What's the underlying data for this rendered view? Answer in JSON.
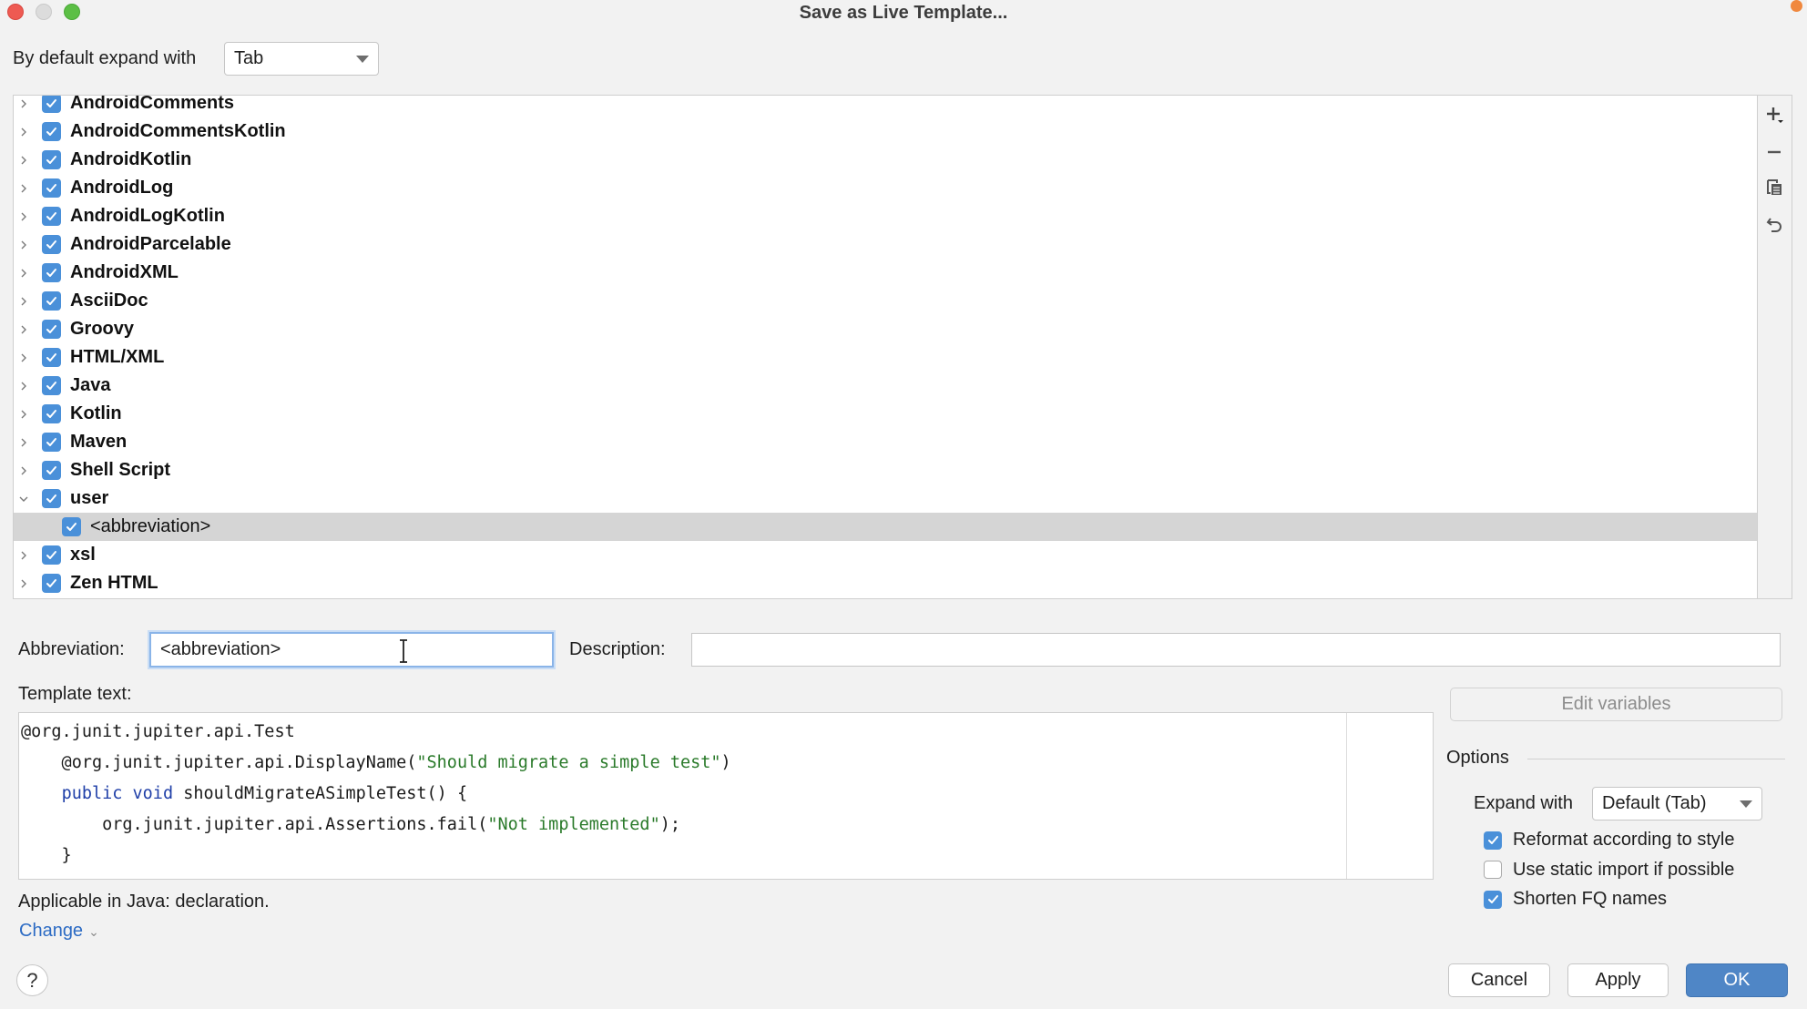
{
  "window": {
    "title": "Save as Live Template..."
  },
  "header": {
    "expand_label": "By default expand with",
    "expand_value": "Tab"
  },
  "tree": {
    "items": [
      {
        "label": "AndroidComments",
        "expanded": false,
        "checked": true,
        "level": 0
      },
      {
        "label": "AndroidCommentsKotlin",
        "expanded": false,
        "checked": true,
        "level": 0
      },
      {
        "label": "AndroidKotlin",
        "expanded": false,
        "checked": true,
        "level": 0
      },
      {
        "label": "AndroidLog",
        "expanded": false,
        "checked": true,
        "level": 0
      },
      {
        "label": "AndroidLogKotlin",
        "expanded": false,
        "checked": true,
        "level": 0
      },
      {
        "label": "AndroidParcelable",
        "expanded": false,
        "checked": true,
        "level": 0
      },
      {
        "label": "AndroidXML",
        "expanded": false,
        "checked": true,
        "level": 0
      },
      {
        "label": "AsciiDoc",
        "expanded": false,
        "checked": true,
        "level": 0
      },
      {
        "label": "Groovy",
        "expanded": false,
        "checked": true,
        "level": 0
      },
      {
        "label": "HTML/XML",
        "expanded": false,
        "checked": true,
        "level": 0
      },
      {
        "label": "Java",
        "expanded": false,
        "checked": true,
        "level": 0
      },
      {
        "label": "Kotlin",
        "expanded": false,
        "checked": true,
        "level": 0
      },
      {
        "label": "Maven",
        "expanded": false,
        "checked": true,
        "level": 0
      },
      {
        "label": "Shell Script",
        "expanded": false,
        "checked": true,
        "level": 0
      },
      {
        "label": "user",
        "expanded": true,
        "checked": true,
        "level": 0
      },
      {
        "label": "<abbreviation>",
        "expanded": null,
        "checked": true,
        "level": 1,
        "selected": true
      },
      {
        "label": "xsl",
        "expanded": false,
        "checked": true,
        "level": 0
      },
      {
        "label": "Zen HTML",
        "expanded": false,
        "checked": true,
        "level": 0
      }
    ],
    "toolbar": [
      "add-icon",
      "remove-icon",
      "copy-icon",
      "restore-icon"
    ]
  },
  "form": {
    "abbreviation_label": "Abbreviation:",
    "abbreviation_value": "<abbreviation>",
    "description_label": "Description:",
    "description_value": "",
    "template_text_label": "Template text:",
    "template_lines": [
      [
        {
          "t": "@org.junit.jupiter.api.Test",
          "c": ""
        }
      ],
      [
        {
          "t": "    @org.junit.jupiter.api.DisplayName(",
          "c": ""
        },
        {
          "t": "\"Should migrate a simple test\"",
          "c": "str"
        },
        {
          "t": ")",
          "c": ""
        }
      ],
      [
        {
          "t": "    ",
          "c": ""
        },
        {
          "t": "public",
          "c": "kw"
        },
        {
          "t": " ",
          "c": ""
        },
        {
          "t": "void",
          "c": "kw"
        },
        {
          "t": " shouldMigrateASimpleTest() {",
          "c": ""
        }
      ],
      [
        {
          "t": "        org.junit.jupiter.api.Assertions.fail(",
          "c": ""
        },
        {
          "t": "\"Not implemented\"",
          "c": "str"
        },
        {
          "t": ");",
          "c": ""
        }
      ],
      [
        {
          "t": "    }",
          "c": ""
        }
      ]
    ],
    "applicable_text": "Applicable in Java: declaration.",
    "change_link": "Change"
  },
  "options": {
    "edit_variables_label": "Edit variables",
    "title": "Options",
    "expand_with_label": "Expand with",
    "expand_with_value": "Default (Tab)",
    "checkboxes": [
      {
        "label": "Reformat according to style",
        "checked": true
      },
      {
        "label": "Use static import if possible",
        "checked": false
      },
      {
        "label": "Shorten FQ names",
        "checked": true
      }
    ]
  },
  "footer": {
    "help_label": "?",
    "cancel_label": "Cancel",
    "apply_label": "Apply",
    "ok_label": "OK"
  },
  "colors": {
    "accent": "#4a90d9",
    "primary_button": "#4f86c6",
    "link": "#2c6bc4",
    "selection": "#d5d5d5",
    "keyword": "#1f3fa8",
    "string": "#2a7a2a"
  }
}
